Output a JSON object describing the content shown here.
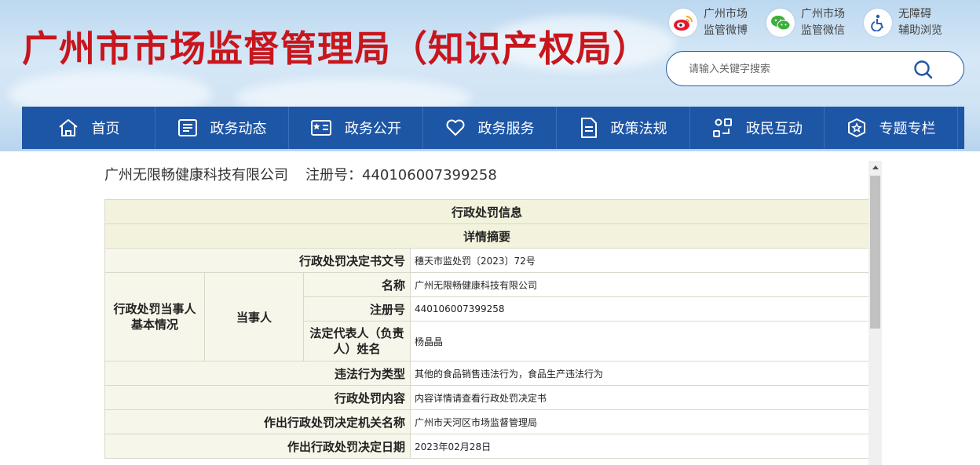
{
  "header": {
    "title": "广州市市场监督管理局（知识产权局）",
    "quick_links": [
      {
        "icon": "weibo-icon",
        "line1": "广州市场",
        "line2": "监管微博"
      },
      {
        "icon": "wechat-icon",
        "line1": "广州市场",
        "line2": "监管微信"
      },
      {
        "icon": "accessibility-icon",
        "line1": "无障碍",
        "line2": "辅助浏览"
      }
    ],
    "search": {
      "placeholder": "请输入关键字搜索"
    }
  },
  "nav": {
    "items": [
      {
        "label": "首页",
        "icon": "home-icon"
      },
      {
        "label": "政务动态",
        "icon": "news-icon"
      },
      {
        "label": "政务公开",
        "icon": "open-gov-icon"
      },
      {
        "label": "政务服务",
        "icon": "heart-icon"
      },
      {
        "label": "政策法规",
        "icon": "document-icon"
      },
      {
        "label": "政民互动",
        "icon": "interaction-icon"
      },
      {
        "label": "专题专栏",
        "icon": "badge-icon"
      }
    ]
  },
  "company": {
    "name": "广州无限畅健康科技有限公司",
    "reg_label": "注册号：",
    "reg_no": "440106007399258"
  },
  "penalty": {
    "section_title": "行政处罚信息",
    "summary_title": "详情摘要",
    "doc_no_label": "行政处罚决定书文号",
    "doc_no": "穗天市监处罚〔2023〕72号",
    "party_group_label": "行政处罚当事人基本情况",
    "party_label": "当事人",
    "name_label": "名称",
    "name": "广州无限畅健康科技有限公司",
    "reg_label": "注册号",
    "reg_no": "440106007399258",
    "legal_rep_label": "法定代表人（负责人）姓名",
    "legal_rep": "杨晶晶",
    "violation_type_label": "违法行为类型",
    "violation_type": "其他的食品销售违法行为，食品生产违法行为",
    "content_label": "行政处罚内容",
    "content": "内容详情请查看行政处罚决定书",
    "authority_label": "作出行政处罚决定机关名称",
    "authority": "广州市天河区市场监督管理局",
    "date_label": "作出行政处罚决定日期",
    "date": "2023年02月28日"
  },
  "colors": {
    "title_red": "#c8161d",
    "nav_blue": "#1e56a6",
    "label_bg": "#f7f6ea"
  }
}
